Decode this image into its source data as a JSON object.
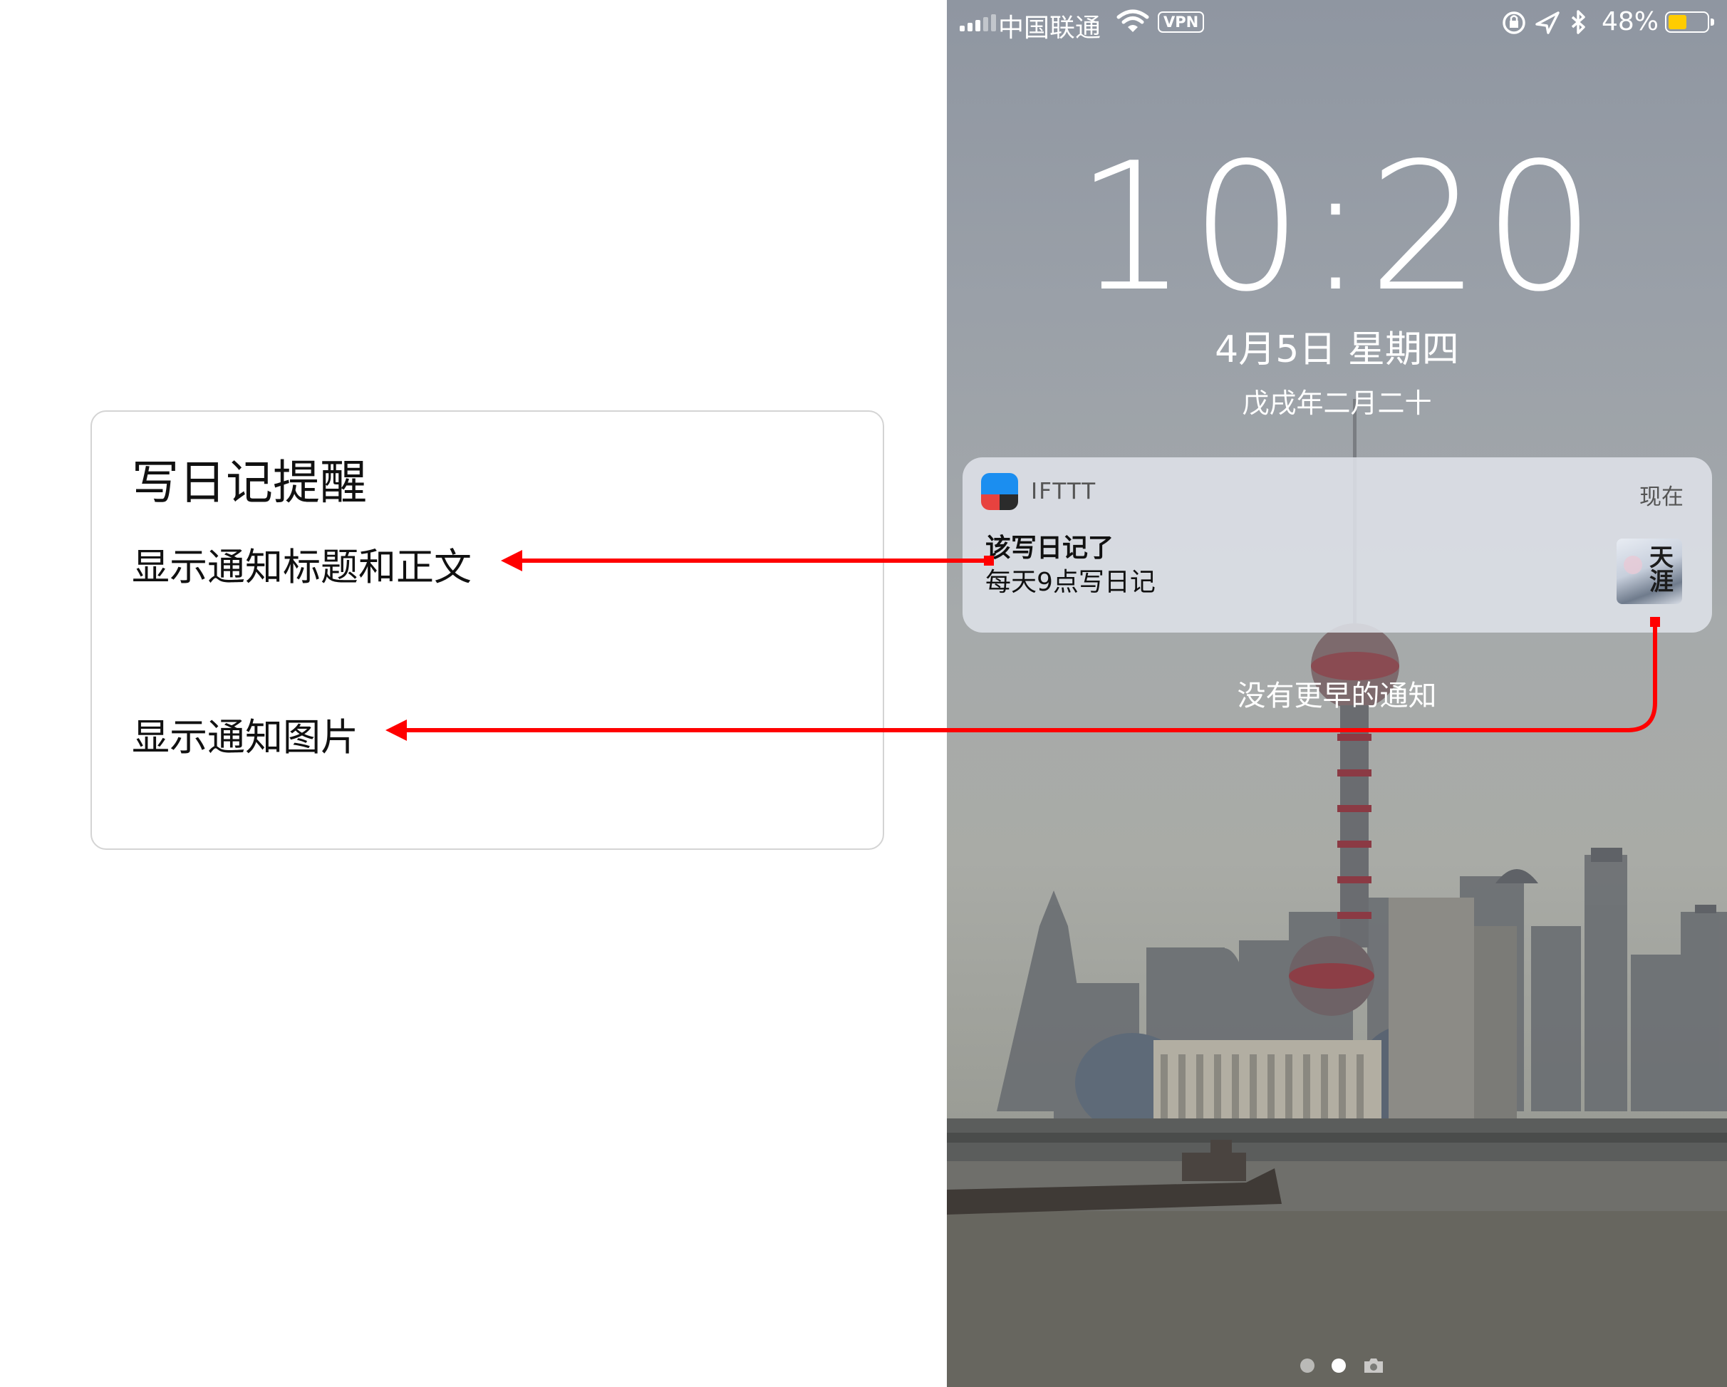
{
  "annotation_card": {
    "title": "写日记提醒",
    "line_title_body": "显示通知标题和正文",
    "line_image": "显示通知图片"
  },
  "status_bar": {
    "carrier": "中国联通",
    "vpn": "VPN",
    "battery_pct": "48%",
    "battery_level": 0.48,
    "colors": {
      "battery_fill": "#ffcc00"
    }
  },
  "lock_screen": {
    "time": "10:20",
    "date": "4月5日 星期四",
    "lunar_date": "戊戌年二月二十",
    "no_earlier": "没有更早的通知"
  },
  "notification": {
    "app_name": "IFTTT",
    "time": "现在",
    "title": "该写日记了",
    "body": "每天9点写日记",
    "thumbnail_text": "天涯",
    "icon": "ifttt-app-icon"
  },
  "colors": {
    "arrow": "#ff0000"
  }
}
